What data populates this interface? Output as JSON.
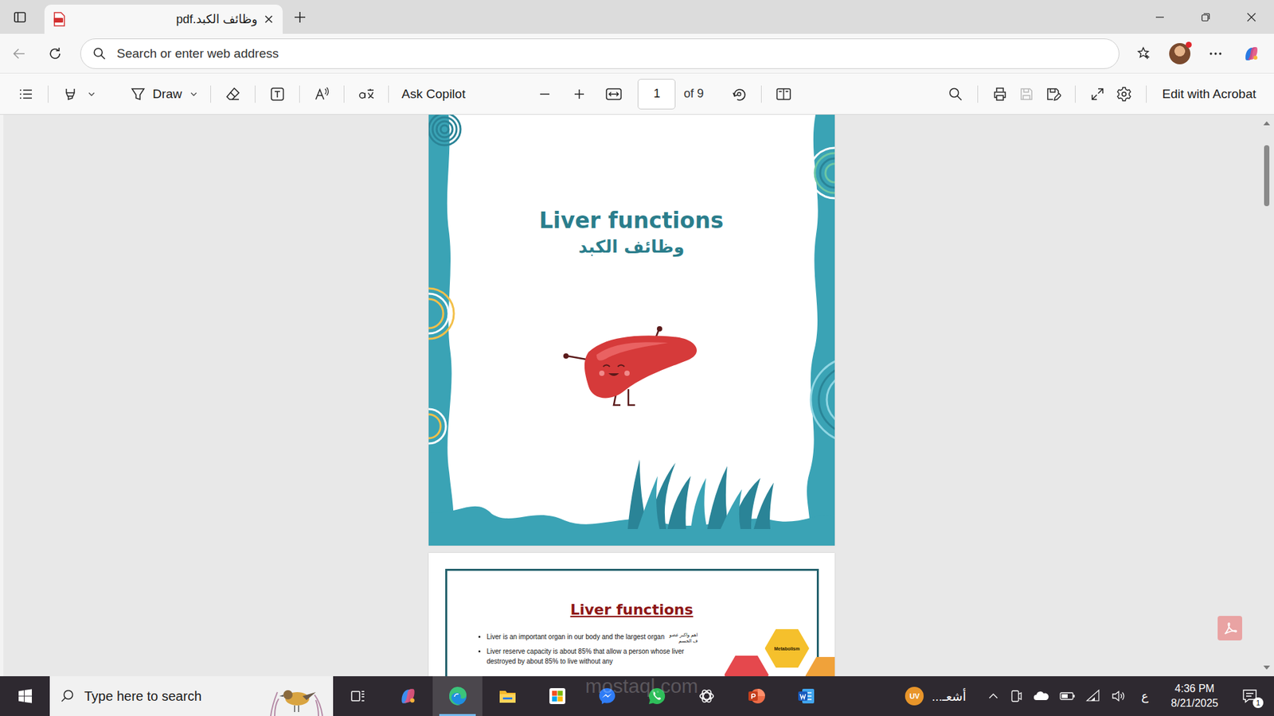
{
  "tabs": [
    {
      "label": "وظائف الكبد.pdf",
      "selected": true
    }
  ],
  "address_bar": {
    "placeholder": "Search or enter web address"
  },
  "pdf_toolbar": {
    "draw": "Draw",
    "ask_copilot": "Ask Copilot",
    "page": "1",
    "page_count": "of 9",
    "edit_with_acrobat": "Edit with Acrobat",
    "save_disabled": true
  },
  "document": {
    "cover": {
      "title": "Liver functions",
      "subtitle": "وظائف الكبد"
    },
    "page2": {
      "title": "Liver functions",
      "bullets": [
        {
          "text": "Liver is an important organ in our body and the largest organ",
          "note": "اهم واكبر عضو ف الجسم"
        },
        {
          "text": "Liver reserve capacity is about 85% that allow a person whose liver destroyed by about 85% to live without any",
          "note": ""
        }
      ],
      "hexagons": [
        {
          "label": "Metabolism",
          "color": "#f5c02c"
        },
        {
          "label": "",
          "color": "#e5484d"
        },
        {
          "label": "",
          "color": "#f0a23a"
        }
      ]
    }
  },
  "taskbar": {
    "search_placeholder": "Type here to search",
    "apps": [
      {
        "kind": "task-view",
        "active": false
      },
      {
        "kind": "copilot",
        "active": false
      },
      {
        "kind": "edge",
        "active": true
      },
      {
        "kind": "explorer",
        "active": false
      },
      {
        "kind": "store",
        "active": false
      },
      {
        "kind": "messenger",
        "active": false
      },
      {
        "kind": "whatsapp",
        "active": false
      },
      {
        "kind": "chatgpt",
        "active": false
      },
      {
        "kind": "powerpoint",
        "active": false
      },
      {
        "kind": "word",
        "active": false
      }
    ],
    "weather": {
      "badge": "UV",
      "text": "أشعـ..."
    },
    "input_language": "ع",
    "time": "4:36 PM",
    "date": "8/21/2025",
    "notification_count": "1"
  },
  "watermark": "mostaql.com"
}
